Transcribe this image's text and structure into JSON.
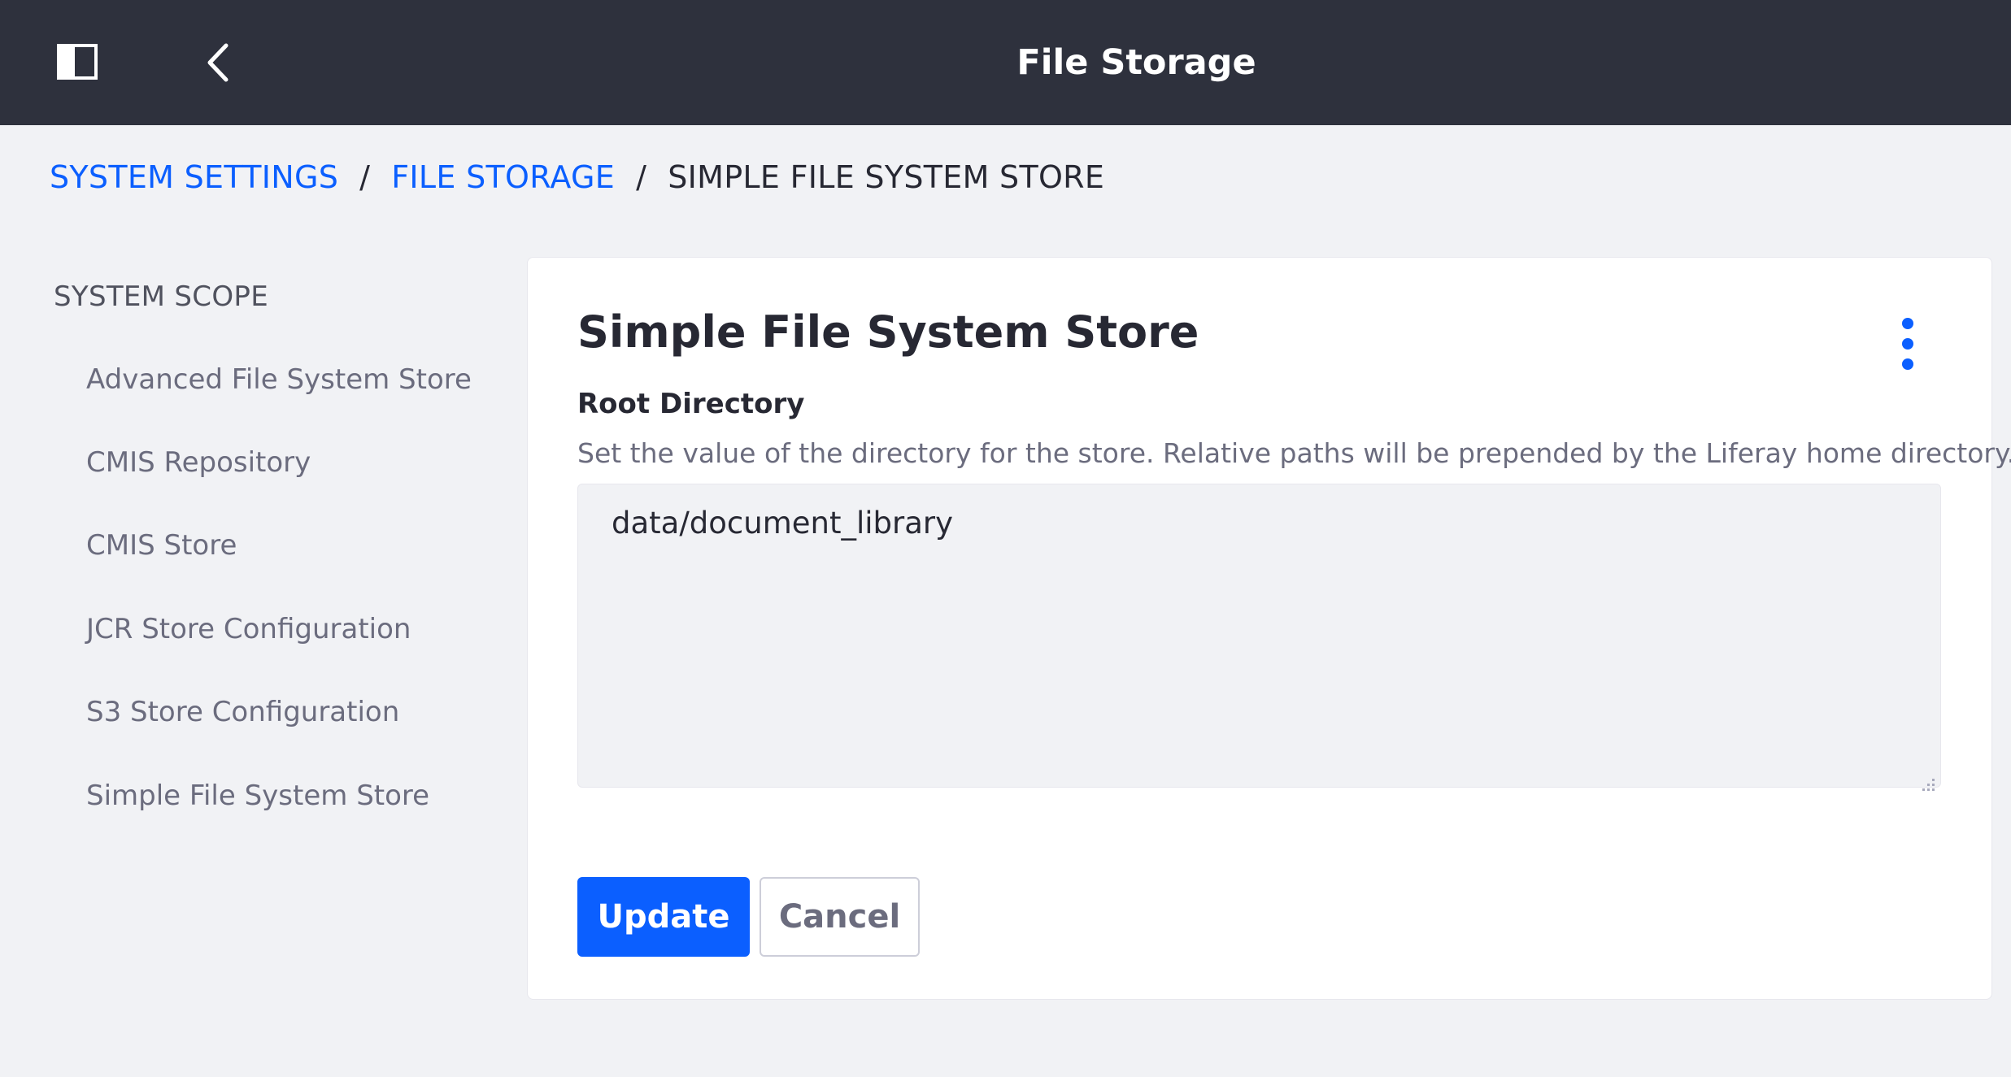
{
  "header": {
    "title": "File Storage",
    "panel_toggle_icon": "panel-toggle-icon",
    "back_icon": "chevron-left-icon"
  },
  "breadcrumb": {
    "items": [
      "SYSTEM SETTINGS",
      "FILE STORAGE"
    ],
    "separator": "/",
    "current": "SIMPLE FILE SYSTEM STORE"
  },
  "sidebar": {
    "scope_title": "SYSTEM SCOPE",
    "items": [
      {
        "label": "Advanced File System Store"
      },
      {
        "label": "CMIS Repository"
      },
      {
        "label": "CMIS Store"
      },
      {
        "label": "JCR Store Configuration"
      },
      {
        "label": "S3 Store Configuration"
      },
      {
        "label": "Simple File System Store"
      }
    ]
  },
  "main": {
    "title": "Simple File System Store",
    "menu_icon": "ellipsis-vertical-icon",
    "field": {
      "label": "Root Directory",
      "help": "Set the value of the directory for the store. Relative paths will be prepended by the Liferay home directory.",
      "value": "data/document_library"
    },
    "buttons": {
      "update": "Update",
      "cancel": "Cancel"
    }
  },
  "colors": {
    "header_bg": "#2e313d",
    "page_bg": "#f1f2f5",
    "accent": "#0b5fff",
    "text_dark": "#272833",
    "text_muted": "#6b6c7e"
  }
}
